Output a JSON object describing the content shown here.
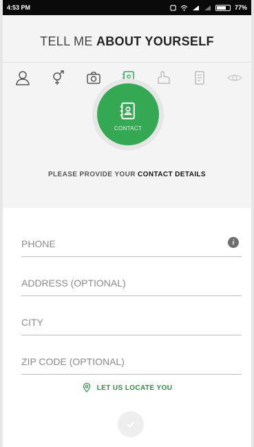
{
  "status_bar": {
    "time": "4:53 PM",
    "battery": "77%",
    "battery_level": 0.77
  },
  "header": {
    "title_light": "TELL ME ",
    "title_bold": "ABOUT YOURSELF"
  },
  "steps": [
    {
      "icon": "user-icon",
      "state": "done"
    },
    {
      "icon": "gender-icon",
      "state": "done"
    },
    {
      "icon": "camera-icon",
      "state": "done"
    },
    {
      "icon": "contact-book-icon",
      "state": "active"
    },
    {
      "icon": "hand-icon",
      "state": "pending"
    },
    {
      "icon": "document-icon",
      "state": "pending"
    },
    {
      "icon": "eye-icon",
      "state": "pending"
    }
  ],
  "current_step": {
    "label": "CONTACT"
  },
  "prompt": {
    "light": "PLEASE PROVIDE YOUR ",
    "bold": "CONTACT DETAILS"
  },
  "form": {
    "phone_placeholder": "PHONE",
    "address_placeholder": "ADDRESS (OPTIONAL)",
    "city_placeholder": "CITY",
    "zip_placeholder": "ZIP CODE (OPTIONAL)",
    "info_icon": "i"
  },
  "locate": {
    "label": "LET US LOCATE YOU"
  },
  "colors": {
    "accent": "#34a853",
    "accent_text": "#2a8f43",
    "status_bar": "#0a0a0a"
  }
}
